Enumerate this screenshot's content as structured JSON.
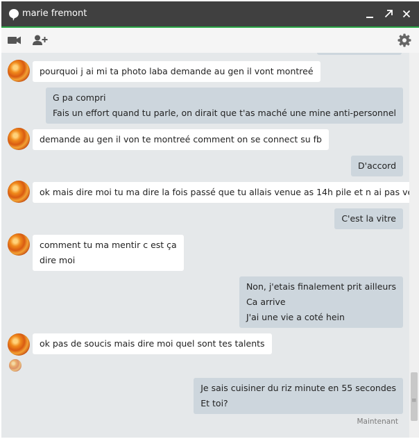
{
  "window": {
    "contact_name": "marie fremont"
  },
  "timestamp": "Maintenant",
  "messages": [
    {
      "dir": "in",
      "lines": [
        "pourquoi j ai mi ta photo laba demande au gen il vont montreé"
      ]
    },
    {
      "dir": "out",
      "lines": [
        "G pa compri",
        "Fais un effort quand tu parle, on dirait que t'as maché une mine anti-personnel"
      ]
    },
    {
      "dir": "in",
      "lines": [
        "demande au gen il von te montreé comment on se connect su fb"
      ]
    },
    {
      "dir": "out",
      "lines": [
        "D'accord"
      ]
    },
    {
      "dir": "in",
      "lines": [
        "ok mais dire moi tu ma dire la fois passé que tu allais venue as 14h pile et n ai pas venue"
      ]
    },
    {
      "dir": "out",
      "lines": [
        "C'est la vitre"
      ]
    },
    {
      "dir": "in",
      "lines": [
        "comment tu ma mentir c est ça",
        "dire moi"
      ]
    },
    {
      "dir": "out",
      "lines": [
        "Non, j'etais finalement prit ailleurs",
        "Ca arrive",
        "J'ai une vie a coté hein"
      ]
    },
    {
      "dir": "in",
      "lines": [
        "ok pas de soucis mais dire moi quel sont tes talents"
      ]
    },
    {
      "dir": "out",
      "lines": [
        "Je sais cuisiner du riz minute en 55 secondes",
        "Et toi?"
      ]
    }
  ]
}
